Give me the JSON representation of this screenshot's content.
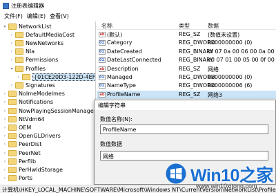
{
  "window": {
    "title": "注册表编辑器"
  },
  "menu": [
    "文件(F)",
    "编辑(E)",
    "查看(V)"
  ],
  "tree": [
    {
      "label": "NetworkList",
      "indent": 0,
      "expanded": true
    },
    {
      "label": "DefaultMediaCost",
      "indent": 1,
      "expanded": false
    },
    {
      "label": "NewNetworks",
      "indent": 1,
      "expanded": false
    },
    {
      "label": "Nla",
      "indent": 1,
      "expanded": false
    },
    {
      "label": "Permissions",
      "indent": 1,
      "expanded": false
    },
    {
      "label": "Profiles",
      "indent": 1,
      "expanded": true
    },
    {
      "label": "{01CE20D3-122D-4EF0",
      "indent": 2,
      "expanded": false,
      "selected": true
    },
    {
      "label": "Signatures",
      "indent": 1,
      "expanded": false
    },
    {
      "label": "NoImeModelmes",
      "indent": 0,
      "expanded": false
    },
    {
      "label": "Notifications",
      "indent": 0,
      "expanded": false
    },
    {
      "label": "NowPlayingSessionManager",
      "indent": 0,
      "expanded": false
    },
    {
      "label": "NtVdm64",
      "indent": 0,
      "expanded": false
    },
    {
      "label": "OEM",
      "indent": 0,
      "expanded": false
    },
    {
      "label": "OpenGLDrivers",
      "indent": 0,
      "expanded": false
    },
    {
      "label": "PeerDist",
      "indent": 0,
      "expanded": false
    },
    {
      "label": "PeerNet",
      "indent": 0,
      "expanded": false
    },
    {
      "label": "Perflib",
      "indent": 0,
      "expanded": false
    },
    {
      "label": "PerHwIdStorage",
      "indent": 0,
      "expanded": false
    },
    {
      "label": "Ports",
      "indent": 0,
      "expanded": false
    }
  ],
  "values_header": {
    "name": "名称",
    "type": "类型",
    "data": "数据"
  },
  "values": [
    {
      "name": "(默认)",
      "type": "REG_SZ",
      "data": "(数值未设置)",
      "icon": "ab"
    },
    {
      "name": "Category",
      "type": "REG_DWORD",
      "data": "0x00000000 (0)",
      "icon": "bin"
    },
    {
      "name": "DateCreated",
      "type": "REG_BINARY",
      "data": "df 07 0a 00 06 00 0a 00 11 00",
      "icon": "bin"
    },
    {
      "name": "DateLastConnected",
      "type": "REG_BINARY",
      "data": "e0 07 01 00 05 00 0f 00 0e 00",
      "icon": "bin"
    },
    {
      "name": "Description",
      "type": "REG_SZ",
      "data": "网络",
      "icon": "ab"
    },
    {
      "name": "Managed",
      "type": "REG_DWORD",
      "data": "0x00000000 (0)",
      "icon": "bin"
    },
    {
      "name": "NameType",
      "type": "REG_DWORD",
      "data": "0x00000006 (6)",
      "icon": "bin"
    },
    {
      "name": "ProfileName",
      "type": "REG_SZ",
      "data": "网络3",
      "icon": "ab",
      "selected": true
    }
  ],
  "dialog": {
    "title": "编辑字符串",
    "name_label": "数值名称(N):",
    "name_value": "ProfileName",
    "data_label": "数值数据",
    "data_value": "网络"
  },
  "statusbar": "计算机\\HKEY_LOCAL_MACHINE\\SOFTWARE\\Microsoft\\Windows NT\\CurrentVersion\\NetworkList\\Profiles",
  "watermark": {
    "brand": "Win10",
    "brand_suffix": "之家",
    "url": "www.win10xitong.com"
  }
}
